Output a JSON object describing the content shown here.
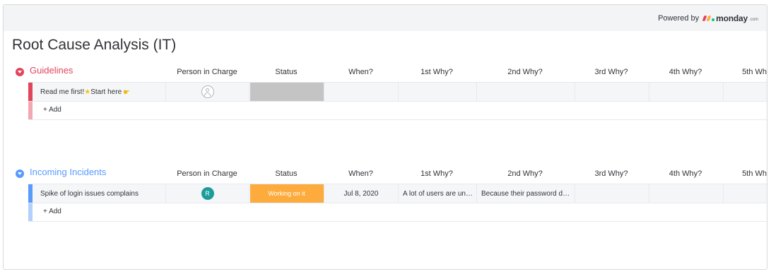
{
  "powered": {
    "text": "Powered by",
    "brand": "monday",
    "brand_suffix": ".com"
  },
  "board": {
    "title": "Root Cause Analysis (IT)"
  },
  "columns": [
    "Person in Charge",
    "Status",
    "When?",
    "1st Why?",
    "2nd Why?",
    "3rd Why?",
    "4th Why?",
    "5th Wh"
  ],
  "groups": [
    {
      "name": "Guidelines",
      "color": "#e2445c",
      "text_color": "#e2445c",
      "toggle_color": "#e2445c",
      "add_label": "+ Add",
      "item": {
        "name_part1": "Read me first!",
        "name_part2": "Start here",
        "person": "",
        "status": "",
        "status_color": "#c4c4c4",
        "when": "",
        "why1": "",
        "why2": ""
      }
    },
    {
      "name": "Incoming Incidents",
      "color": "#579bfc",
      "text_color": "#579bfc",
      "toggle_color": "#579bfc",
      "add_label": "+ Add",
      "item": {
        "name": "Spike of login issues complains",
        "person": "R",
        "person_color": "#1c9c9c",
        "status": "Working on it",
        "status_color": "#fdab3d",
        "when": "Jul 8, 2020",
        "why1": "A lot of users are un…",
        "why2": "Because their password d…"
      }
    }
  ]
}
